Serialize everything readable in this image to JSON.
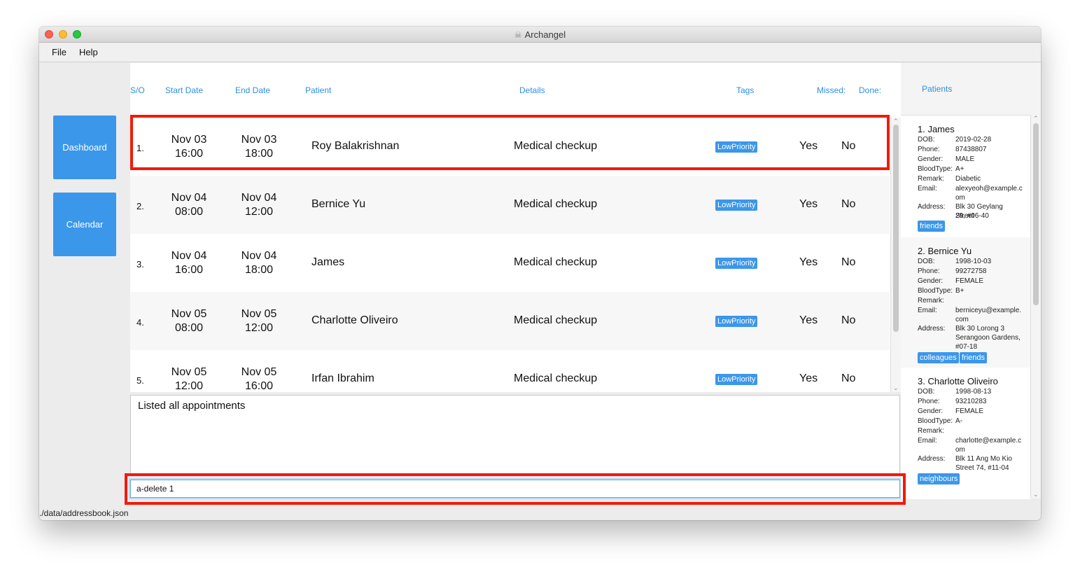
{
  "window": {
    "title": "Archangel"
  },
  "menu": {
    "file": "File",
    "help": "Help"
  },
  "sidebar": {
    "dashboard": "Dashboard",
    "calendar": "Calendar"
  },
  "columns": {
    "sn": "S/O",
    "start": "Start Date",
    "end": "End Date",
    "patient": "Patient",
    "details": "Details",
    "tags": "Tags",
    "missed": "Missed:",
    "done": "Done:"
  },
  "appointments": [
    {
      "sn": "1.",
      "start_day": "Nov 03",
      "start_time": "16:00",
      "end_day": "Nov 03",
      "end_time": "18:00",
      "patient": "Roy Balakrishnan",
      "details": "Medical checkup",
      "tag": "LowPriority",
      "missed": "Yes",
      "done": "No"
    },
    {
      "sn": "2.",
      "start_day": "Nov 04",
      "start_time": "08:00",
      "end_day": "Nov 04",
      "end_time": "12:00",
      "patient": "Bernice Yu",
      "details": "Medical checkup",
      "tag": "LowPriority",
      "missed": "Yes",
      "done": "No"
    },
    {
      "sn": "3.",
      "start_day": "Nov 04",
      "start_time": "16:00",
      "end_day": "Nov 04",
      "end_time": "18:00",
      "patient": "James",
      "details": "Medical checkup",
      "tag": "LowPriority",
      "missed": "Yes",
      "done": "No"
    },
    {
      "sn": "4.",
      "start_day": "Nov 05",
      "start_time": "08:00",
      "end_day": "Nov 05",
      "end_time": "12:00",
      "patient": "Charlotte Oliveiro",
      "details": "Medical checkup",
      "tag": "LowPriority",
      "missed": "Yes",
      "done": "No"
    },
    {
      "sn": "5.",
      "start_day": "Nov 05",
      "start_time": "12:00",
      "end_day": "Nov 05",
      "end_time": "16:00",
      "patient": "Irfan Ibrahim",
      "details": "Medical checkup",
      "tag": "LowPriority",
      "missed": "Yes",
      "done": "No"
    }
  ],
  "result": {
    "text": "Listed all appointments"
  },
  "command": {
    "value": "a-delete 1"
  },
  "status": {
    "path": "./data/addressbook.json"
  },
  "patients_panel": {
    "title": "Patients",
    "labels": {
      "dob": "DOB:",
      "phone": "Phone:",
      "gender": "Gender:",
      "blood": "BloodType:",
      "remark": "Remark:",
      "email": "Email:",
      "address": "Address:"
    },
    "items": [
      {
        "name": "1. James",
        "dob": "2019-02-28",
        "phone": "87438807",
        "gender": "MALE",
        "blood": "A+",
        "remark": "Diabetic",
        "email_1": "alexyeoh@example.c",
        "email_2": "om",
        "address_1": "Blk 30 Geylang Street",
        "address_2": "29, #06-40",
        "tags": [
          "friends"
        ]
      },
      {
        "name": "2. Bernice Yu",
        "dob": "1998-10-03",
        "phone": "99272758",
        "gender": "FEMALE",
        "blood": "B+",
        "remark": "",
        "email_1": "berniceyu@example.",
        "email_2": "com",
        "address_1": "Blk 30 Lorong 3",
        "address_2": "Serangoon Gardens,",
        "address_3": "#07-18",
        "tags": [
          "colleagues",
          "friends"
        ]
      },
      {
        "name": "3. Charlotte Oliveiro",
        "dob": "1998-08-13",
        "phone": "93210283",
        "gender": "FEMALE",
        "blood": "A-",
        "remark": "",
        "email_1": "charlotte@example.c",
        "email_2": "om",
        "address_1": "Blk 11 Ang Mo Kio",
        "address_2": "Street 74, #11-04",
        "tags": [
          "neighbours"
        ]
      }
    ]
  },
  "colors": {
    "accent": "#3b97ea",
    "header_text": "#2f8fe0",
    "highlight": "#f21a0a"
  }
}
